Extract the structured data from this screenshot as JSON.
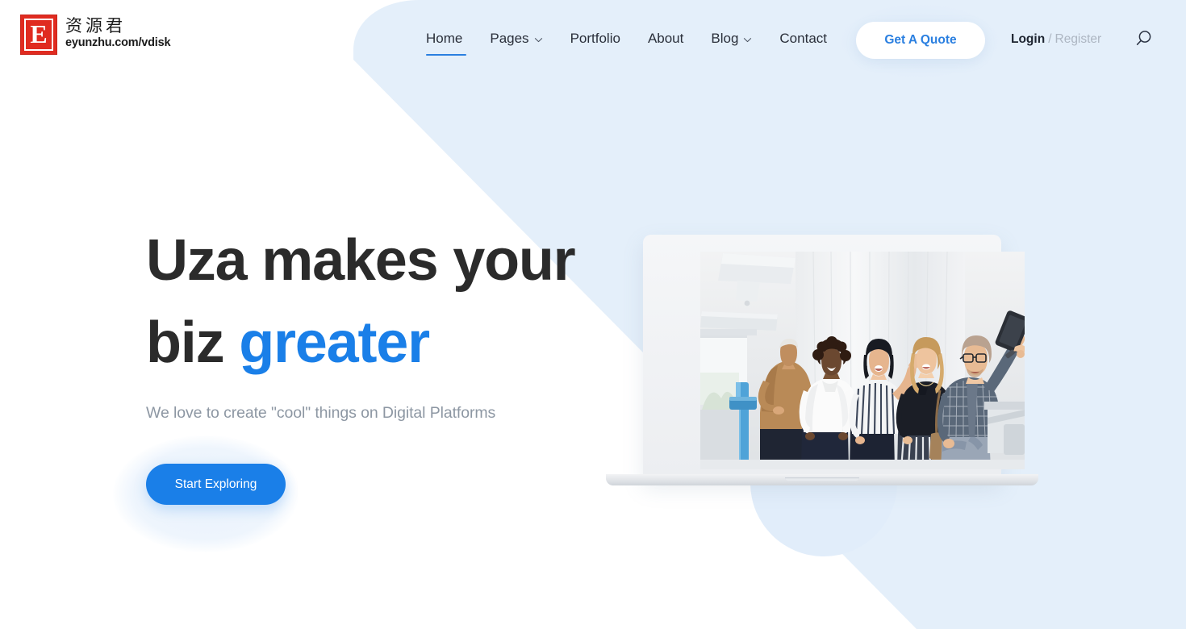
{
  "brand": {
    "mark_letter": "E",
    "name_cn": "资源君",
    "url": "eyunzhu.com/vdisk"
  },
  "nav": {
    "items": [
      {
        "label": "Home",
        "has_dropdown": false,
        "active": true
      },
      {
        "label": "Pages",
        "has_dropdown": true,
        "active": false
      },
      {
        "label": "Portfolio",
        "has_dropdown": false,
        "active": false
      },
      {
        "label": "About",
        "has_dropdown": false,
        "active": false
      },
      {
        "label": "Blog",
        "has_dropdown": true,
        "active": false
      },
      {
        "label": "Contact",
        "has_dropdown": false,
        "active": false
      }
    ]
  },
  "header": {
    "quote_button": "Get A Quote",
    "login": "Login",
    "separator": "/",
    "register": "Register",
    "search_icon": "search-icon"
  },
  "hero": {
    "title_line1": "Uza makes your",
    "title_line2_plain": "biz ",
    "title_line2_accent": "greater",
    "subtitle": "We love to create \"cool\" things on Digital Platforms",
    "cta": "Start Exploring",
    "image_alt": "laptop-mockup-group-selfie"
  },
  "colors": {
    "accent_blue": "#1a7fe8",
    "nav_blue": "#2a7fe0",
    "bg_light_blue": "#e4effa",
    "heading_dark": "#2b2b2b",
    "muted_gray": "#8d97a3",
    "logo_red": "#e02b20",
    "page_white": "#ffffff"
  }
}
